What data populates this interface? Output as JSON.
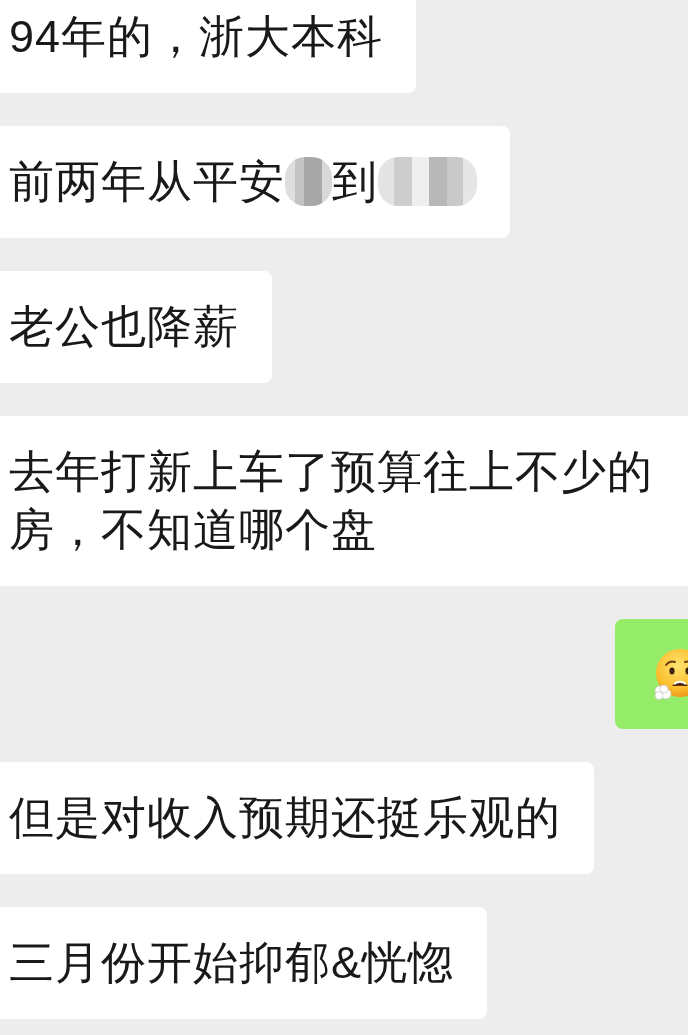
{
  "messages": [
    {
      "outgoing": false,
      "kind": "text",
      "text": "94年的，浙大本科"
    },
    {
      "outgoing": false,
      "kind": "segments",
      "segments": [
        {
          "kind": "text",
          "text": "前两年从平安"
        },
        {
          "kind": "redacted"
        },
        {
          "kind": "text",
          "text": "到"
        },
        {
          "kind": "redacted"
        }
      ]
    },
    {
      "outgoing": false,
      "kind": "text",
      "text": "老公也降薪"
    },
    {
      "outgoing": false,
      "kind": "text",
      "text": "去年打新上车了预算往上不少的房，不知道哪个盘"
    },
    {
      "outgoing": true,
      "kind": "emoji"
    },
    {
      "outgoing": false,
      "kind": "text",
      "text": "但是对收入预期还挺乐观的"
    },
    {
      "outgoing": false,
      "kind": "text",
      "text": "三月份开始抑郁&恍惚"
    }
  ]
}
